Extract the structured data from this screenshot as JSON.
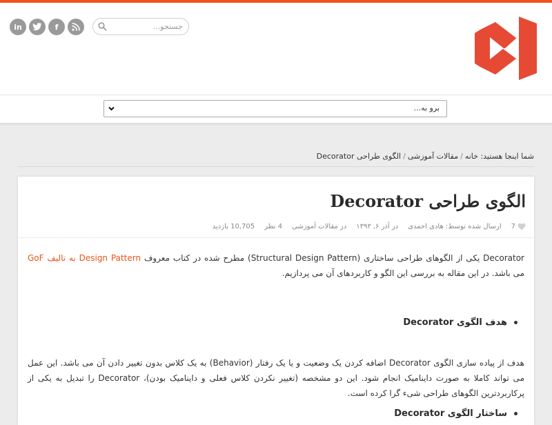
{
  "colors": {
    "accent": "#f0511d",
    "logo": "#e64a35",
    "link": "#e8541a"
  },
  "social": [
    {
      "name": "linkedin",
      "label": "in"
    },
    {
      "name": "twitter",
      "label": ""
    },
    {
      "name": "facebook",
      "label": "f"
    },
    {
      "name": "rss",
      "label": ""
    }
  ],
  "search": {
    "placeholder": "جستجو..."
  },
  "logo": {
    "icon": "visual-studio-logo-icon"
  },
  "nav": {
    "selected": "برو به..."
  },
  "breadcrumb": {
    "prefix": "شما اینجا هستید:",
    "home": "خانه",
    "category": "مقالات آموزشی",
    "current": "الگوی طراحی Decorator"
  },
  "post": {
    "title": "الگوی طراحی Decorator",
    "likes": "7",
    "author": "ارسال شده توسط: هادی احمدی",
    "date": "در آذر ۶, ۱۳۹۳",
    "category": "در مقالات آموزشی",
    "comments": "4 نظر",
    "views": "10,705 بازدید",
    "p1_start": "Decorator یکی از الگوهای طراحی ساختاری (Structural Design Pattern) مطرح شده در کتاب معروف ",
    "p1_link": "Design Pattern به تالیف GoF",
    "p1_end": " می باشد. در این مقاله به بررسی این الگو و کاربردهای آن می پردازیم.",
    "heading1": "هدف الگوی Decorator",
    "p2": "هدف از پیاده سازی الگوی Decorator اضافه کردن یک وضعیت و یا یک رفتار (Behavior) به یک کلاس بدون تغییر دادن آن می باشد. این عمل می تواند کاملا به صورت داینامیک انجام شود. این دو مشخصه (تغییر نکردن کلاس فعلی و داینامیک بودن)، Decorator را تبدیل به یکی از پرکاربردترین الگوهای طراحی شیء گرا کرده است.",
    "heading2": "ساختار الگوی Decorator"
  }
}
